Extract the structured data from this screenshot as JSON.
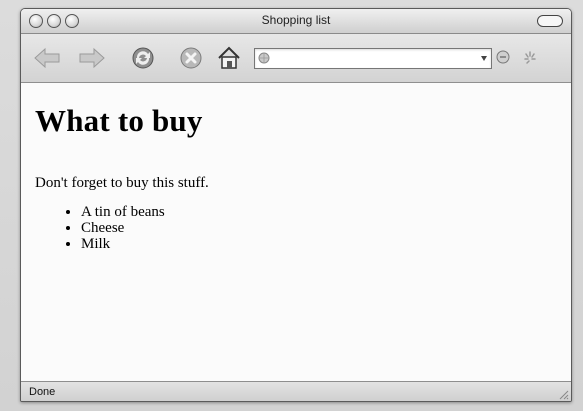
{
  "window": {
    "title": "Shopping list"
  },
  "toolbar": {
    "buttons": [
      {
        "name": "back",
        "icon": "arrow-left-icon"
      },
      {
        "name": "forward",
        "icon": "arrow-right-icon"
      },
      {
        "name": "reload",
        "icon": "reload-icon"
      },
      {
        "name": "stop",
        "icon": "stop-icon"
      },
      {
        "name": "home",
        "icon": "home-icon"
      }
    ],
    "address": {
      "value": "",
      "icon": "globe-icon"
    },
    "go": {
      "icon": "go-icon"
    },
    "activity": {
      "icon": "throbber-icon"
    }
  },
  "page": {
    "heading": "What to buy",
    "paragraph": "Don't forget to buy this stuff.",
    "items": [
      "A tin of beans",
      "Cheese",
      "Milk"
    ]
  },
  "status": {
    "text": "Done"
  },
  "colors": {
    "window_border": "#5a5a5a",
    "content_bg": "#fbfbfb",
    "chrome": "#d8d8d8"
  }
}
